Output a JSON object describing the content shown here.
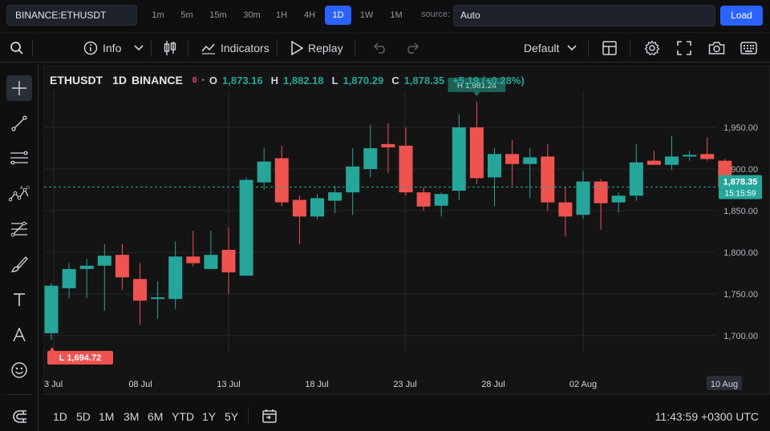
{
  "topbar": {
    "symbol": "BINANCE:ETHUSDT",
    "timeframes": [
      "1m",
      "5m",
      "15m",
      "30m",
      "1H",
      "4H",
      "1D",
      "1W",
      "1M"
    ],
    "active_timeframe": "1D",
    "source_label": "source:",
    "source_value": "Auto",
    "load_label": "Load"
  },
  "toolbar": {
    "info_label": "Info",
    "indicators_label": "Indicators",
    "replay_label": "Replay",
    "layout_label": "Default"
  },
  "left_tools": [
    "crosshair-icon",
    "trendline-icon",
    "fib-icon",
    "pattern-icon",
    "forecast-icon",
    "brush-icon",
    "text-icon",
    "annotation-icon",
    "emoji-icon",
    "magnet-icon"
  ],
  "legend": {
    "symbol": "ETHUSDT",
    "interval": "1D",
    "exchange": "BINANCE",
    "badge": "0",
    "o_label": "O",
    "o_value": "1,873.16",
    "h_label": "H",
    "h_value": "1,882.18",
    "l_label": "L",
    "l_value": "1,870.29",
    "c_label": "C",
    "c_value": "1,878.35",
    "change": "+5.19 (+0.28%)"
  },
  "chart_data": {
    "type": "candlestick",
    "x_labels": [
      "3 Jul",
      "08 Jul",
      "13 Jul",
      "18 Jul",
      "23 Jul",
      "28 Jul",
      "02 Aug",
      "10 Aug"
    ],
    "y_ticks": [
      "1,950.00",
      "1,900.00",
      "1,850.00",
      "1,800.00",
      "1,750.00",
      "1,700.00"
    ],
    "ylim": [
      1675,
      1995
    ],
    "last_price": "1,878.35",
    "countdown": "15:15:59",
    "high_marker": "H 1,981.24",
    "low_marker": "L 1,694.72",
    "colors": {
      "up": "#26a69a",
      "down": "#ef5350"
    },
    "candles": [
      {
        "o": 1703,
        "h": 1763,
        "l": 1695,
        "c": 1760
      },
      {
        "o": 1757,
        "h": 1787,
        "l": 1745,
        "c": 1780
      },
      {
        "o": 1780,
        "h": 1792,
        "l": 1745,
        "c": 1784
      },
      {
        "o": 1784,
        "h": 1810,
        "l": 1730,
        "c": 1796
      },
      {
        "o": 1797,
        "h": 1810,
        "l": 1755,
        "c": 1770
      },
      {
        "o": 1768,
        "h": 1787,
        "l": 1713,
        "c": 1742
      },
      {
        "o": 1744,
        "h": 1765,
        "l": 1720,
        "c": 1746
      },
      {
        "o": 1744,
        "h": 1813,
        "l": 1732,
        "c": 1795
      },
      {
        "o": 1795,
        "h": 1826,
        "l": 1783,
        "c": 1787
      },
      {
        "o": 1780,
        "h": 1826,
        "l": 1780,
        "c": 1797
      },
      {
        "o": 1803,
        "h": 1830,
        "l": 1750,
        "c": 1776
      },
      {
        "o": 1772,
        "h": 1890,
        "l": 1772,
        "c": 1887
      },
      {
        "o": 1884,
        "h": 1925,
        "l": 1875,
        "c": 1909
      },
      {
        "o": 1913,
        "h": 1928,
        "l": 1855,
        "c": 1860
      },
      {
        "o": 1863,
        "h": 1868,
        "l": 1810,
        "c": 1843
      },
      {
        "o": 1843,
        "h": 1870,
        "l": 1840,
        "c": 1865
      },
      {
        "o": 1862,
        "h": 1880,
        "l": 1847,
        "c": 1872
      },
      {
        "o": 1872,
        "h": 1925,
        "l": 1845,
        "c": 1903
      },
      {
        "o": 1900,
        "h": 1953,
        "l": 1890,
        "c": 1925
      },
      {
        "o": 1930,
        "h": 1955,
        "l": 1895,
        "c": 1926
      },
      {
        "o": 1928,
        "h": 1950,
        "l": 1868,
        "c": 1872
      },
      {
        "o": 1872,
        "h": 1878,
        "l": 1850,
        "c": 1855
      },
      {
        "o": 1856,
        "h": 1872,
        "l": 1843,
        "c": 1870
      },
      {
        "o": 1874,
        "h": 1966,
        "l": 1863,
        "c": 1950
      },
      {
        "o": 1950,
        "h": 1981,
        "l": 1882,
        "c": 1889
      },
      {
        "o": 1890,
        "h": 1925,
        "l": 1855,
        "c": 1918
      },
      {
        "o": 1918,
        "h": 1935,
        "l": 1880,
        "c": 1906
      },
      {
        "o": 1906,
        "h": 1925,
        "l": 1865,
        "c": 1914
      },
      {
        "o": 1915,
        "h": 1930,
        "l": 1850,
        "c": 1860
      },
      {
        "o": 1860,
        "h": 1878,
        "l": 1819,
        "c": 1843
      },
      {
        "o": 1845,
        "h": 1898,
        "l": 1840,
        "c": 1885
      },
      {
        "o": 1885,
        "h": 1888,
        "l": 1827,
        "c": 1859
      },
      {
        "o": 1860,
        "h": 1872,
        "l": 1848,
        "c": 1868
      },
      {
        "o": 1868,
        "h": 1930,
        "l": 1862,
        "c": 1908
      },
      {
        "o": 1910,
        "h": 1922,
        "l": 1905,
        "c": 1905
      },
      {
        "o": 1905,
        "h": 1940,
        "l": 1899,
        "c": 1915
      },
      {
        "o": 1915,
        "h": 1922,
        "l": 1910,
        "c": 1917
      },
      {
        "o": 1918,
        "h": 1938,
        "l": 1910,
        "c": 1912
      },
      {
        "o": 1910,
        "h": 1912,
        "l": 1870,
        "c": 1878
      }
    ]
  },
  "bottombar": {
    "ranges": [
      "1D",
      "5D",
      "1M",
      "3M",
      "6M",
      "YTD",
      "1Y",
      "5Y"
    ],
    "clock": "11:43:59 +0300 UTC"
  }
}
